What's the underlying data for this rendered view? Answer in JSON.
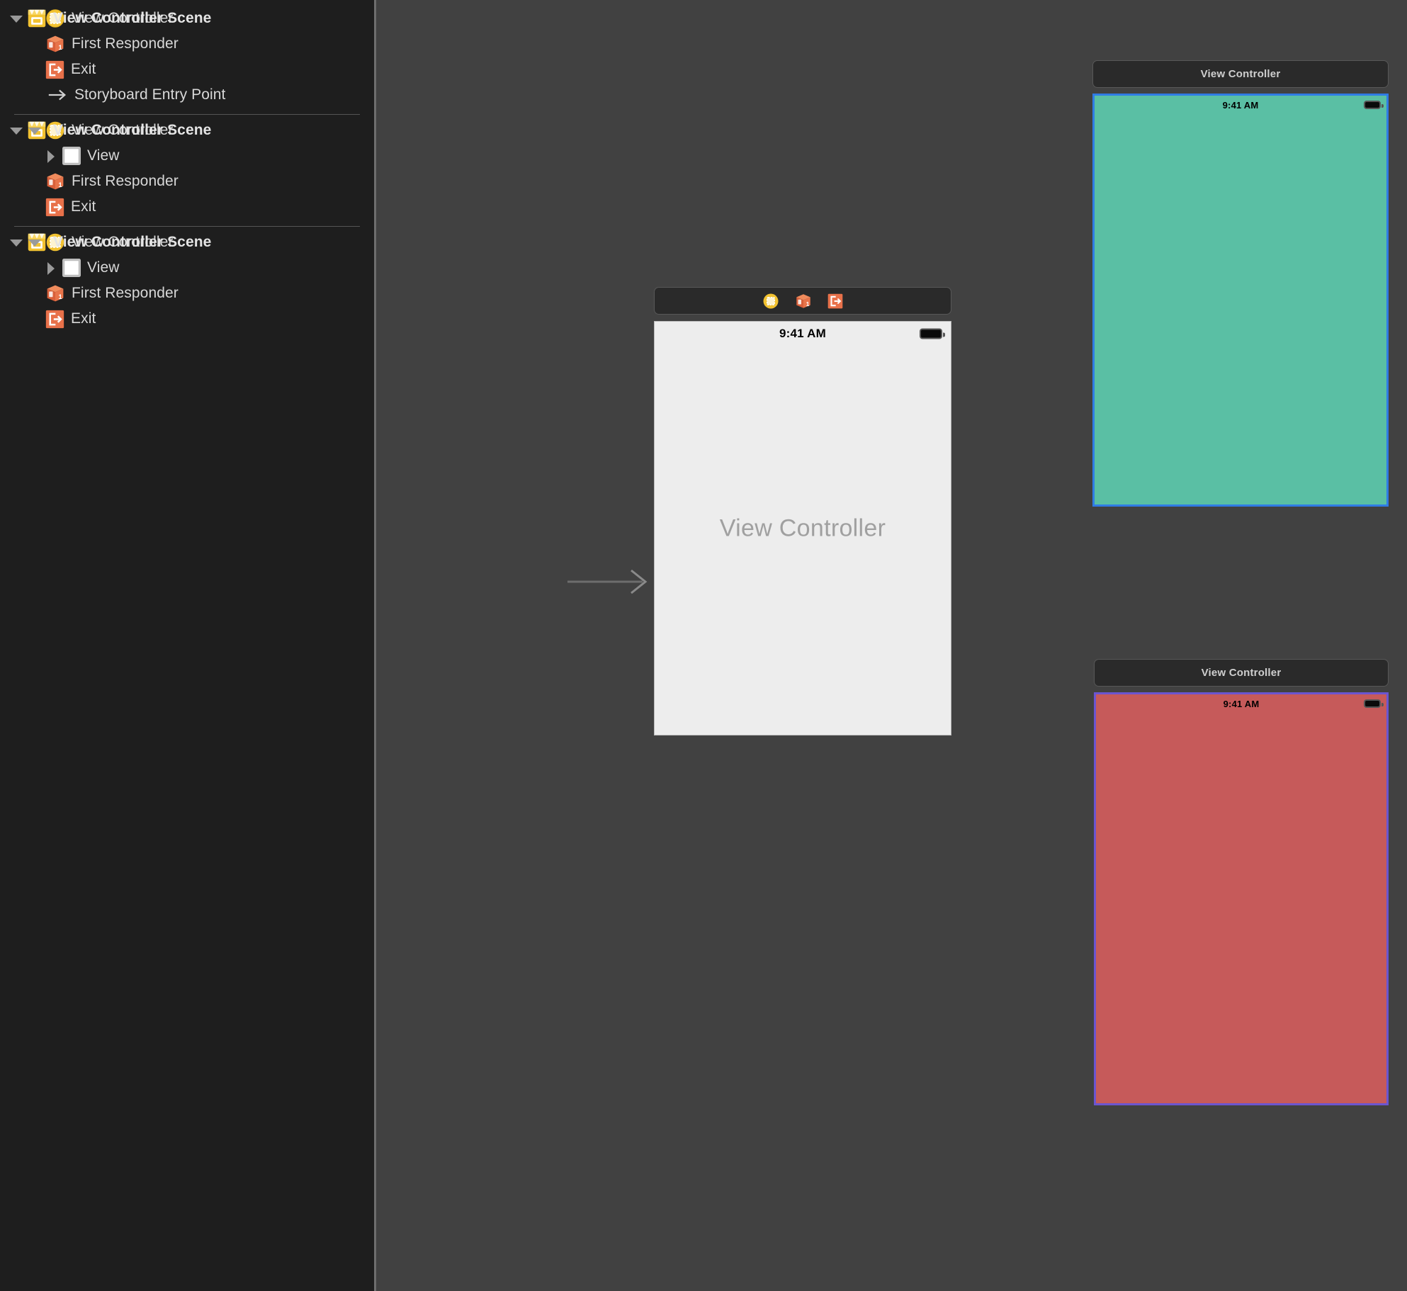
{
  "outline": {
    "groups": [
      {
        "name": "scene-group-1",
        "scene_label": "View Controller Scene",
        "scene_icon": "storyboard-scene-icon",
        "expanded": true,
        "items": [
          {
            "label": "View Controller",
            "icon": "view-controller-icon",
            "indent": 1,
            "triangle": "none"
          },
          {
            "label": "First Responder",
            "icon": "first-responder-icon",
            "indent": 1,
            "triangle": "none"
          },
          {
            "label": "Exit",
            "icon": "exit-icon",
            "indent": 1,
            "triangle": "none"
          },
          {
            "label": "Storyboard Entry Point",
            "icon": "entry-point-arrow-icon",
            "indent": 1,
            "triangle": "none"
          }
        ]
      },
      {
        "name": "scene-group-2",
        "scene_label": "View Controller Scene",
        "scene_icon": "storyboard-scene-icon",
        "expanded": true,
        "items": [
          {
            "label": "View Controller",
            "icon": "view-controller-icon",
            "indent": 1,
            "triangle": "open"
          },
          {
            "label": "View",
            "icon": "view-icon",
            "indent": 2,
            "triangle": "closed"
          },
          {
            "label": "First Responder",
            "icon": "first-responder-icon",
            "indent": 1,
            "triangle": "none"
          },
          {
            "label": "Exit",
            "icon": "exit-icon",
            "indent": 1,
            "triangle": "none"
          }
        ]
      },
      {
        "name": "scene-group-3",
        "scene_label": "View Controller Scene",
        "scene_icon": "storyboard-scene-icon",
        "expanded": true,
        "items": [
          {
            "label": "View Controller",
            "icon": "view-controller-icon",
            "indent": 1,
            "triangle": "open"
          },
          {
            "label": "View",
            "icon": "view-icon",
            "indent": 2,
            "triangle": "closed"
          },
          {
            "label": "First Responder",
            "icon": "first-responder-icon",
            "indent": 1,
            "triangle": "none"
          },
          {
            "label": "Exit",
            "icon": "exit-icon",
            "indent": 1,
            "triangle": "none"
          }
        ]
      }
    ]
  },
  "canvas": {
    "background_color": "#414141",
    "entry_point_arrow": "storyboard-entry-point-arrow",
    "scenes": [
      {
        "name": "main-view-controller-scene",
        "dock_mode": "icons",
        "dock_icons": [
          "view-controller-icon",
          "first-responder-icon",
          "exit-icon"
        ],
        "status_time": "9:41 AM",
        "placeholder_text": "View Controller",
        "background_color": "#ededed",
        "selection": "none"
      },
      {
        "name": "teal-view-controller-scene",
        "dock_mode": "title",
        "dock_title": "View Controller",
        "status_time": "9:41 AM",
        "background_color": "#5abfa4",
        "selection": "blue",
        "selection_color": "#2f7ce5"
      },
      {
        "name": "red-view-controller-scene",
        "dock_mode": "title",
        "dock_title": "View Controller",
        "status_time": "9:41 AM",
        "background_color": "#c65a5a",
        "selection": "purple",
        "selection_color": "#6b55d0"
      }
    ]
  }
}
